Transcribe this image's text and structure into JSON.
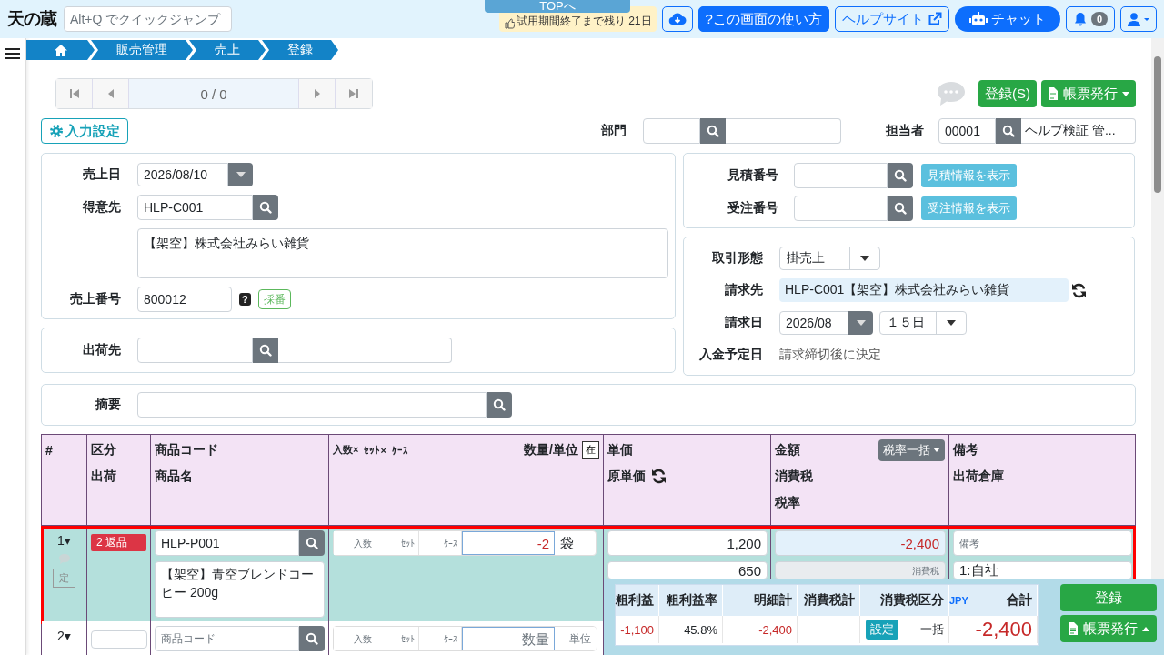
{
  "header": {
    "logo": "天の蔵",
    "search": {
      "placeholder": "Alt+Q でクイックジャンプ"
    },
    "top_tab": "TOPへ",
    "trial_notice": "試用期間終了まで残り 21日",
    "toolbar": [
      {
        "kind": "download"
      },
      {
        "kind": "guide",
        "label": "?この画面の使い方"
      },
      {
        "kind": "help_site",
        "label": "ヘルプサイト"
      },
      {
        "kind": "chat",
        "label": "チャット"
      },
      {
        "kind": "notifications",
        "count": "0"
      },
      {
        "kind": "user"
      }
    ]
  },
  "breadcrumb": [
    "販売管理",
    "売上",
    "登録"
  ],
  "pager": {
    "position": "0 / 0"
  },
  "actions": [
    {
      "kind": "save",
      "label": "登録(S)"
    },
    {
      "kind": "print",
      "label": "帳票発行"
    }
  ],
  "input_settings": "入力設定",
  "department": {
    "label": "部門"
  },
  "staff": {
    "label": "担当者",
    "code": "00001",
    "name": "ヘルプ検証 管..."
  },
  "sale": {
    "date": {
      "label": "売上日",
      "value": "2026/08/10"
    },
    "customer": {
      "label": "得意先",
      "code": "HLP-C001",
      "name": "【架空】株式会社みらい雑貨"
    },
    "number": {
      "label": "売上番号",
      "value": "800012",
      "help": "?",
      "assign_button": "採番"
    }
  },
  "ship_to": {
    "label": "出荷先"
  },
  "references": [
    {
      "label": "見積番号",
      "button": "見積情報を表示"
    },
    {
      "label": "受注番号",
      "button": "受注情報を表示"
    }
  ],
  "billing": {
    "transaction_type": {
      "label": "取引形態",
      "value": "掛売上"
    },
    "bill_to": {
      "label": "請求先",
      "value": "HLP-C001【架空】株式会社みらい雑貨"
    },
    "billing_date": {
      "label": "請求日",
      "month": "2026/08",
      "day": "１５日"
    },
    "payment_due": {
      "label": "入金予定日",
      "value": "請求締切後に決定"
    }
  },
  "memo": {
    "label": "摘要"
  },
  "table": {
    "columns": [
      {
        "kind": "plain",
        "lines": [
          "#"
        ]
      },
      {
        "kind": "plain",
        "lines": [
          "区分",
          "出荷"
        ]
      },
      {
        "kind": "plain",
        "lines": [
          "商品コード",
          "商品名"
        ]
      },
      {
        "kind": "quantity",
        "sub_labels": [
          "入数×",
          "ｾｯﾄ×",
          "ｹｰｽ"
        ],
        "title": "数量/単位",
        "button": "在"
      },
      {
        "kind": "price",
        "lines": [
          "単価",
          "原単価"
        ]
      },
      {
        "kind": "amount",
        "lines": [
          "金額",
          "消費税",
          "税率"
        ],
        "button": "税率一括"
      },
      {
        "kind": "plain",
        "lines": [
          "備考",
          "出荷倉庫"
        ]
      }
    ],
    "rows": [
      {
        "number": "1▾",
        "highlighted": true,
        "fixed": "定",
        "category": "2 返品",
        "color": "#dc3545",
        "code": "HLP-P001",
        "name": "【架空】青空ブレンドコーヒー 200g",
        "qty_placeholders": [
          "入数",
          "ｾｯﾄ",
          "ｹｰｽ"
        ],
        "quantity": "-2",
        "quantity_negative": true,
        "unit": "袋",
        "price": "1,200",
        "cost": "650",
        "amount": "-2,400",
        "amount_negative": true,
        "tax_placeholder": "消費税",
        "remarks_placeholder": "備考",
        "warehouse": "1:自社"
      },
      {
        "number": "2▾",
        "highlighted": false,
        "code_placeholder": "商品コード",
        "qty_placeholders": [
          "入数",
          "ｾｯﾄ",
          "ｹｰｽ"
        ],
        "quantity_placeholder": "数量",
        "unit_placeholder": "単位"
      }
    ]
  },
  "summary": {
    "items": [
      {
        "kind": "amount",
        "label": "粗利益",
        "value": "-1,100",
        "negative": true
      },
      {
        "kind": "amount",
        "label": "粗利益率",
        "value": "45.8%",
        "negative": false
      },
      {
        "kind": "amount",
        "label": "明細計",
        "value": "-2,400",
        "negative": true
      },
      {
        "kind": "amount",
        "label": "消費税計"
      },
      {
        "kind": "tax_mode",
        "label": "消費税区分",
        "button": "設定",
        "value": "一括"
      },
      {
        "kind": "total",
        "label": "合計",
        "currency": "JPY",
        "value": "-2,400",
        "negative": true
      }
    ],
    "buttons": [
      {
        "kind": "save",
        "label": "登録"
      },
      {
        "kind": "print",
        "label": "帳票発行"
      }
    ]
  }
}
